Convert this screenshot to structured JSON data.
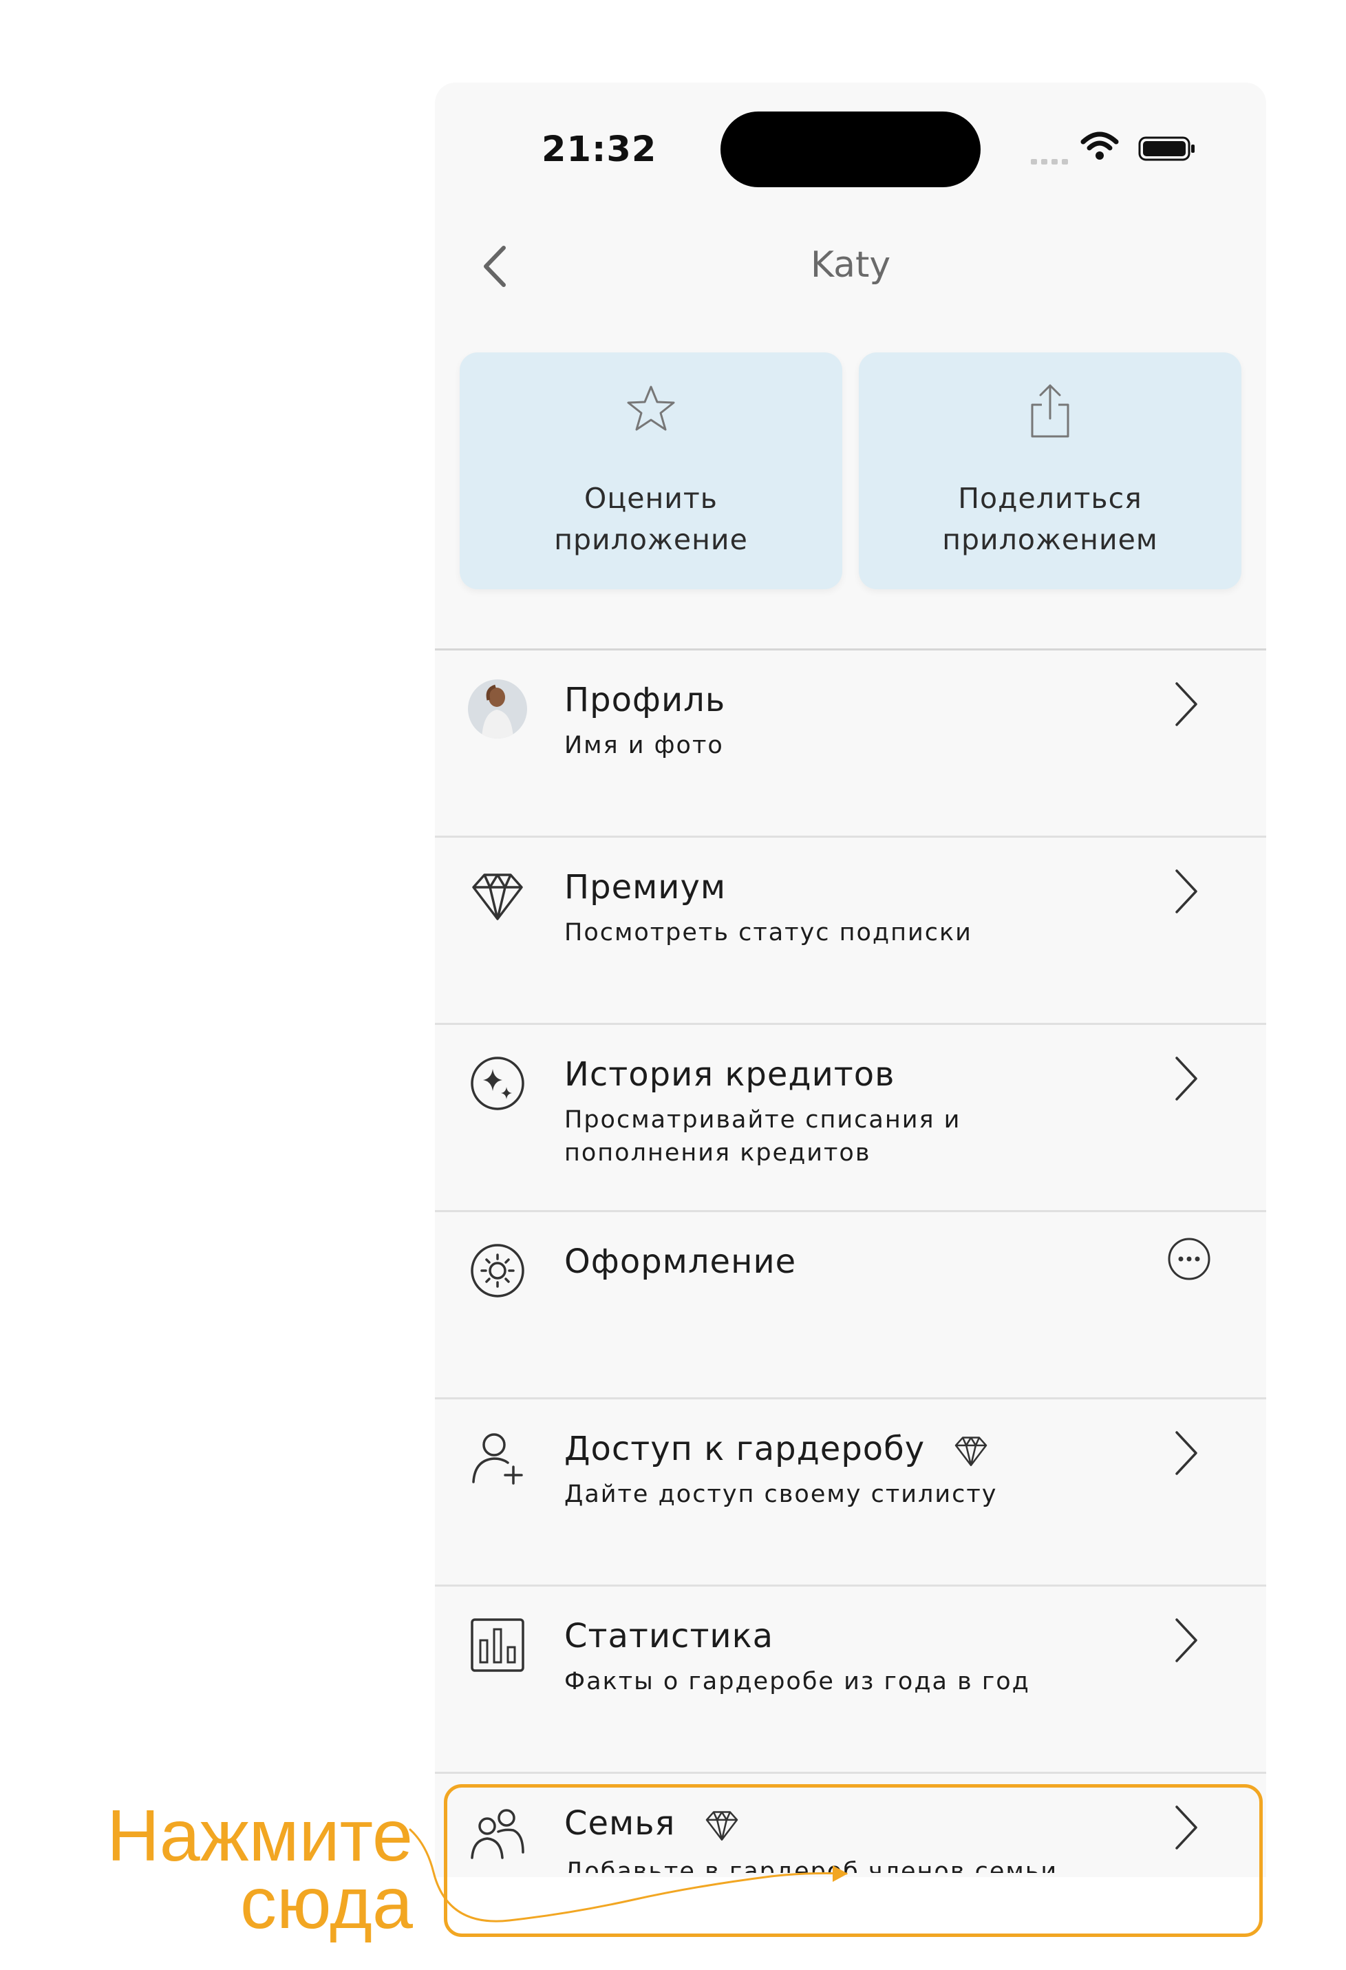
{
  "status_bar": {
    "time": "21:32"
  },
  "nav": {
    "title": "Katy"
  },
  "actions": [
    {
      "label": "Оценить приложение",
      "icon": "star-icon"
    },
    {
      "label": "Поделиться приложением",
      "icon": "share-icon"
    }
  ],
  "menu": [
    {
      "title": "Профиль",
      "subtitle": "Имя и фото",
      "icon": "avatar",
      "trailing": "chevron"
    },
    {
      "title": "Премиум",
      "subtitle": "Посмотреть статус подписки",
      "icon": "diamond-icon",
      "trailing": "chevron"
    },
    {
      "title": "История кредитов",
      "subtitle": "Просматривайте списания и пополнения кредитов",
      "icon": "sparkle-icon",
      "trailing": "chevron"
    },
    {
      "title": "Оформление",
      "subtitle": "",
      "icon": "sun-icon",
      "trailing": "more"
    },
    {
      "title": "Доступ к гардеробу",
      "subtitle": "Дайте доступ своему стилисту",
      "icon": "add-user-icon",
      "trailing": "chevron",
      "premium": true
    },
    {
      "title": "Статистика",
      "subtitle": "Факты о гардеробе из года в год",
      "icon": "bar-chart-icon",
      "trailing": "chevron"
    },
    {
      "title": "Семья",
      "subtitle": "Добавьте в гардероб членов семьи",
      "icon": "family-icon",
      "trailing": "chevron",
      "premium": true
    }
  ],
  "callout": {
    "line1": "Нажмите",
    "line2": "сюда"
  },
  "colors": {
    "accent": "#f2a622",
    "card_bg": "#deedf5",
    "screen_bg": "#f8f8f8"
  }
}
